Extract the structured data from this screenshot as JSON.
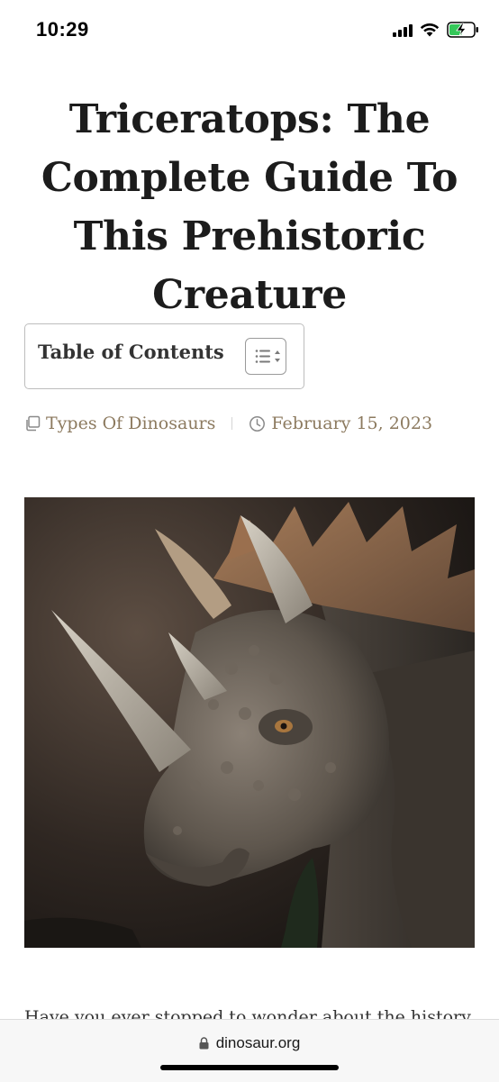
{
  "status_bar": {
    "time": "10:29",
    "battery_color": "#34c759"
  },
  "article": {
    "title": "Triceratops: The Complete Guide To This Prehistoric Creature",
    "toc_label": "Table of Contents",
    "category": "Types Of Dinosaurs",
    "date": "February 15, 2023",
    "body_preview": "Have you ever stopped to wonder about the history"
  },
  "browser": {
    "url": "dinosaur.org"
  },
  "colors": {
    "meta_text": "#8c7a5f",
    "title_text": "#1c1c1c"
  },
  "icons": {
    "category": "copy-icon",
    "date": "clock-icon",
    "toc": "list-toggle-icon",
    "url": "lock-icon"
  }
}
